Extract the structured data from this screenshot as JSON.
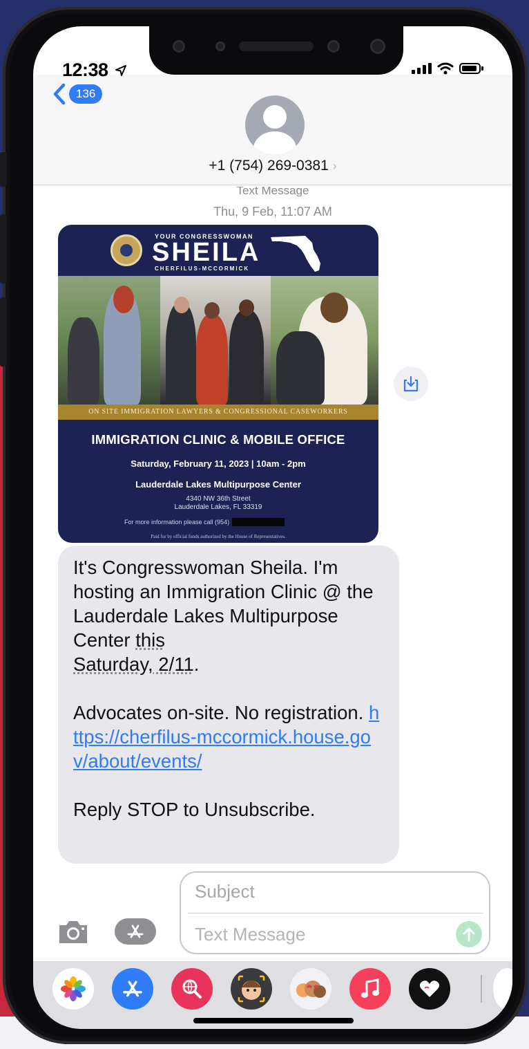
{
  "status": {
    "time": "12:38"
  },
  "header": {
    "back_count": "136",
    "contact_number": "+1 (754) 269-0381",
    "chevron": "›"
  },
  "thread": {
    "label": "Text Message",
    "date": "Thu, 9 Feb, 11:07 AM"
  },
  "flyer": {
    "kicker": "YOUR CONGRESSWOMAN",
    "name": "SHEILA",
    "subname": "CHERFILUS-MCCORMICK",
    "band": "ON SITE IMMIGRATION LAWYERS & CONGRESSIONAL CASEWORKERS",
    "title": "IMMIGRATION CLINIC & MOBILE OFFICE",
    "date": "Saturday, February 11, 2023 | 10am - 2pm",
    "venue": "Lauderdale Lakes Multipurpose Center",
    "address_line1": "4340 NW 36th Street",
    "address_line2": "Lauderdale Lakes, FL 33319",
    "info": "For more information please call (954)",
    "paid_for": "Paid for by official funds authorized by the House of Representatives."
  },
  "message": {
    "p1_start": "It's Congresswoman Sheila. I'm hosting an Immigration Clinic @ the Lauderdale Lakes Multipurpose Center ",
    "p1_this": "this",
    "p1_date": "Saturday, 2/11",
    "p1_end": ".",
    "p2_text": "Advocates on-site. No registration. ",
    "p2_link": "https://cherfilus-mccormick.house.gov/about/events/",
    "p3": "Reply STOP to Unsubscribe."
  },
  "compose": {
    "subject_placeholder": "Subject",
    "message_placeholder": "Text Message"
  },
  "app_drawer": [
    {
      "name": "photos-app-icon",
      "color": "#ffffff"
    },
    {
      "name": "app-store-icon",
      "color": "#2f7cf6"
    },
    {
      "name": "image-search-icon",
      "color": "#e8335a"
    },
    {
      "name": "memoji-icon",
      "color": "#3a3a3c"
    },
    {
      "name": "animoji-icon",
      "color": "#f2f2f6"
    },
    {
      "name": "music-icon",
      "color": "#f6405b"
    },
    {
      "name": "digital-touch-icon",
      "color": "#111111"
    }
  ],
  "colors": {
    "accent": "#2f7cf6",
    "bubble": "#e7e7ec",
    "flyer_navy": "#1c2254",
    "flyer_gold": "#a8842e"
  }
}
